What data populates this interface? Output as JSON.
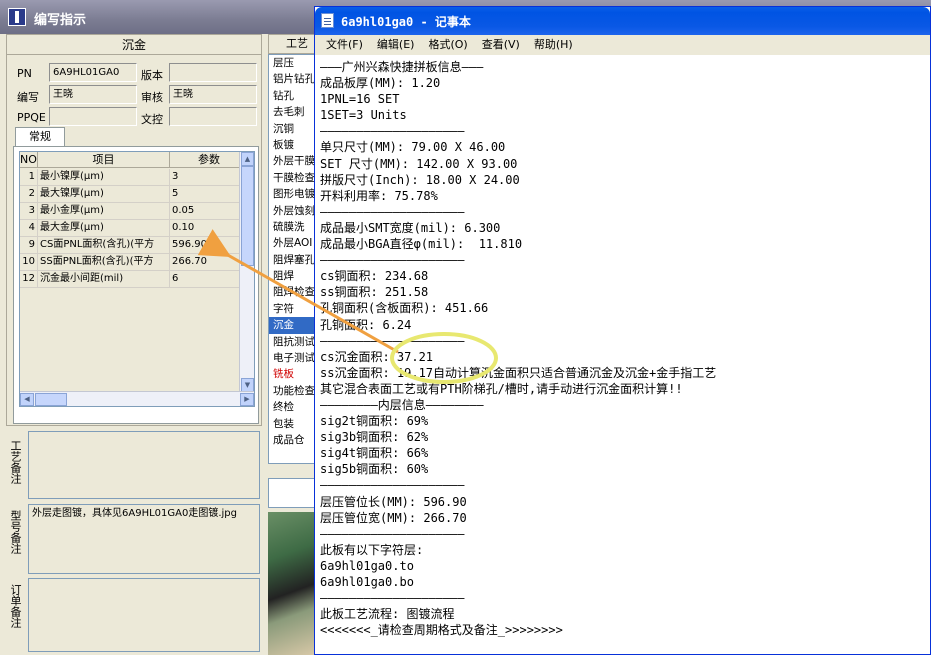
{
  "back_window": {
    "title": "编写指示",
    "group_title": "沉金",
    "fields": {
      "pn_label": "PN",
      "pn_value": "6A9HL01GA0",
      "version_label": "版本",
      "version_value": "",
      "writer_label": "编写",
      "writer_value": "王晓",
      "review_label": "审核",
      "review_value": "王晓",
      "ppqe_label": "PPQE",
      "ppqe_value": "",
      "doc_label": "文控",
      "doc_value": ""
    },
    "tab_label": "常规",
    "table": {
      "headers": [
        "NO",
        "项目",
        "参数"
      ],
      "rows": [
        {
          "no": "1",
          "item": "最小镍厚(μm)",
          "val": "3"
        },
        {
          "no": "2",
          "item": "最大镍厚(μm)",
          "val": "5"
        },
        {
          "no": "3",
          "item": "最小金厚(μm)",
          "val": "0.05"
        },
        {
          "no": "4",
          "item": "最大金厚(μm)",
          "val": "0.10"
        },
        {
          "no": "9",
          "item": "CS面PNL面积(含孔)(平方",
          "val": "596.90"
        },
        {
          "no": "10",
          "item": "SS面PNL面积(含孔)(平方",
          "val": "266.70"
        },
        {
          "no": "12",
          "item": "沉金最小间距(mil)",
          "val": "6"
        }
      ]
    },
    "notes": {
      "process_label": "工艺备注",
      "process_text": "",
      "model_label": "型号备注",
      "model_text": "外层走图镀，具体见6A9HL01GA0走图镀.jpg",
      "order_label": "订单备注",
      "order_text": ""
    },
    "mid_panel": {
      "title": "工艺",
      "items": [
        "层压",
        "铝片钻孔",
        "钻孔",
        "去毛刺",
        "沉铜",
        "板镀",
        "外层干膜",
        "干膜检查",
        "图形电镀",
        "外层蚀刻",
        "硫膜洗",
        "外层AOI",
        "阻焊塞孔",
        "阻焊",
        "阻焊检查",
        "字符",
        "沉金",
        "阻抗测试",
        "电子测试",
        "铣板",
        "功能检查",
        "终检",
        "包装",
        "成品仓"
      ],
      "selected": "沉金",
      "highlight_red": "铣板"
    }
  },
  "notepad": {
    "title": "6a9hl01ga0 - 记事本",
    "menu": [
      "文件(F)",
      "编辑(E)",
      "格式(O)",
      "查看(V)",
      "帮助(H)"
    ],
    "lines": [
      "———广州兴森快捷拼板信息———",
      "成品板厚(MM): 1.20",
      "1PNL=16 SET",
      "1SET=3 Units",
      "————————————————————",
      "单只尺寸(MM): 79.00 X 46.00",
      "SET 尺寸(MM): 142.00 X 93.00",
      "拼版尺寸(Inch): 18.00 X 24.00",
      "开料利用率: 75.78%",
      "————————————————————",
      "成品最小SMT宽度(mil): 6.300",
      "成品最小BGA直径φ(mil):  11.810",
      "————————————————————",
      "cs铜面积: 234.68",
      "ss铜面积: 251.58",
      "孔铜面积(含板面积): 451.66",
      "孔铜面积: 6.24",
      "————————————————————",
      "cs沉金面积: 37.21",
      "ss沉金面积: 19.17自动计算沉金面积只适合普通沉金及沉金+金手指工艺",
      "其它混合表面工艺或有PTH阶梯孔/槽时,请手动进行沉金面积计算!!",
      "————————内层信息————————",
      "sig2t铜面积: 69%",
      "sig3b铜面积: 62%",
      "sig4t铜面积: 66%",
      "sig5b铜面积: 60%",
      "————————————————————",
      "层压管位长(MM): 596.90",
      "层压管位宽(MM): 266.70",
      "————————————————————",
      "此板有以下字符层:",
      "6a9hl01ga0.to",
      "6a9hl01ga0.bo",
      "————————————————————",
      "此板工艺流程: 图镀流程",
      "<<<<<<<_请检查周期格式及备注_>>>>>>>>"
    ]
  },
  "colors": {
    "titlebar_xp": "#0054e3",
    "back_titlebar": "#7b7c92",
    "selection": "#316ac5",
    "annotation_arrow": "#f0a040",
    "annotation_ellipse": "#e8e870"
  }
}
